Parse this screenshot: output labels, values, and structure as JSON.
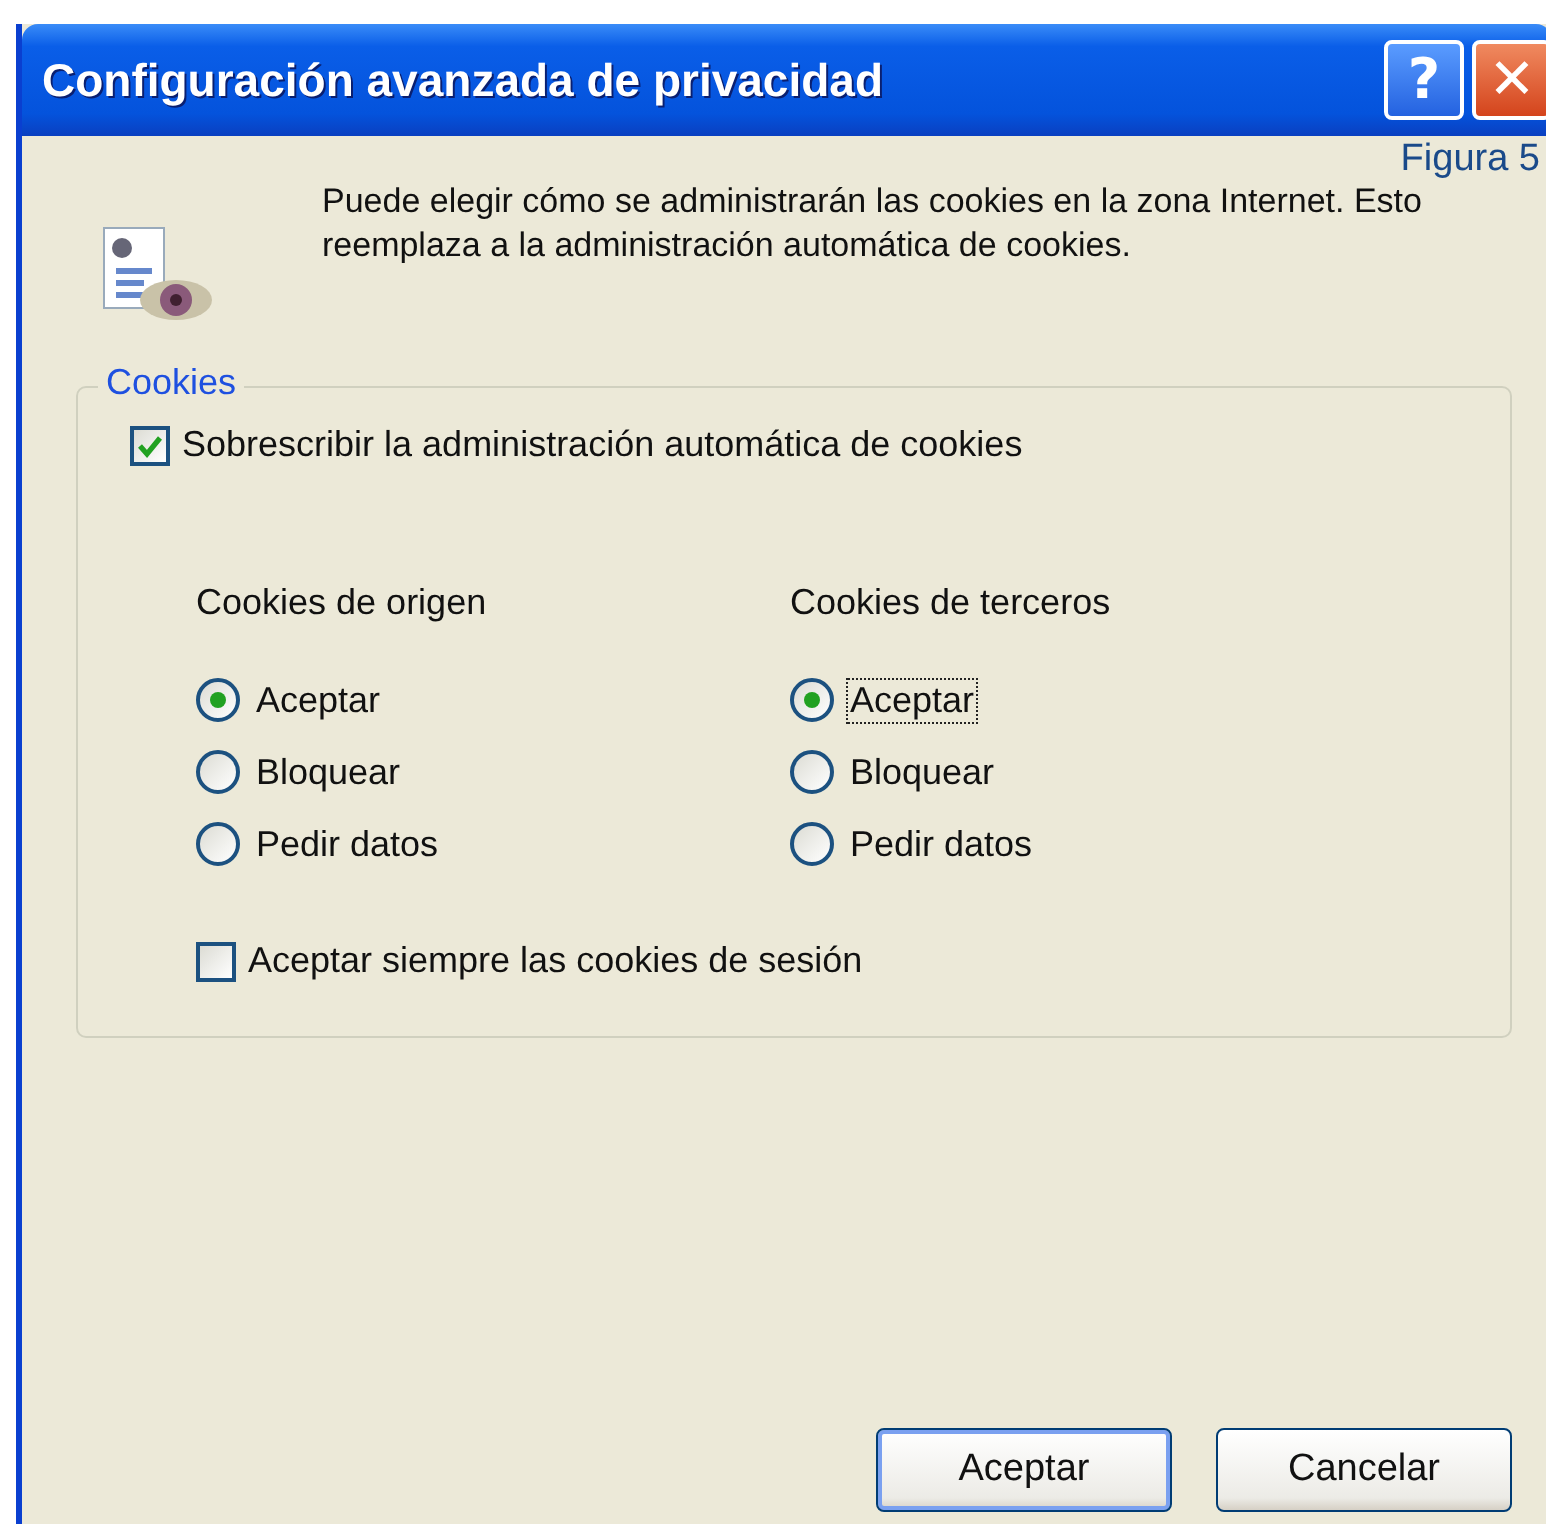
{
  "window": {
    "title": "Configuración avanzada de privacidad",
    "title_buttons": [
      {
        "kind": "help",
        "label": "?"
      },
      {
        "kind": "close",
        "label": "✕"
      }
    ]
  },
  "figure_label": "Figura 5",
  "description": "Puede elegir cómo se administrarán las cookies en la zona Internet. Esto reemplaza a la administración automática de cookies.",
  "cookies_group": {
    "legend": "Cookies",
    "override": {
      "label": "Sobrescribir la administración automática de cookies",
      "checked": true
    },
    "columns": [
      {
        "heading": "Cookies de origen",
        "options": [
          {
            "label": "Aceptar",
            "selected": true,
            "focused": false
          },
          {
            "label": "Bloquear",
            "selected": false,
            "focused": false
          },
          {
            "label": "Pedir datos",
            "selected": false,
            "focused": false
          }
        ]
      },
      {
        "heading": "Cookies de terceros",
        "options": [
          {
            "label": "Aceptar",
            "selected": true,
            "focused": true
          },
          {
            "label": "Bloquear",
            "selected": false,
            "focused": false
          },
          {
            "label": "Pedir datos",
            "selected": false,
            "focused": false
          }
        ]
      }
    ],
    "session": {
      "label": "Aceptar siempre las cookies de sesión",
      "checked": false
    }
  },
  "buttons": [
    {
      "label": "Aceptar",
      "default": true
    },
    {
      "label": "Cancelar",
      "default": false
    }
  ]
}
